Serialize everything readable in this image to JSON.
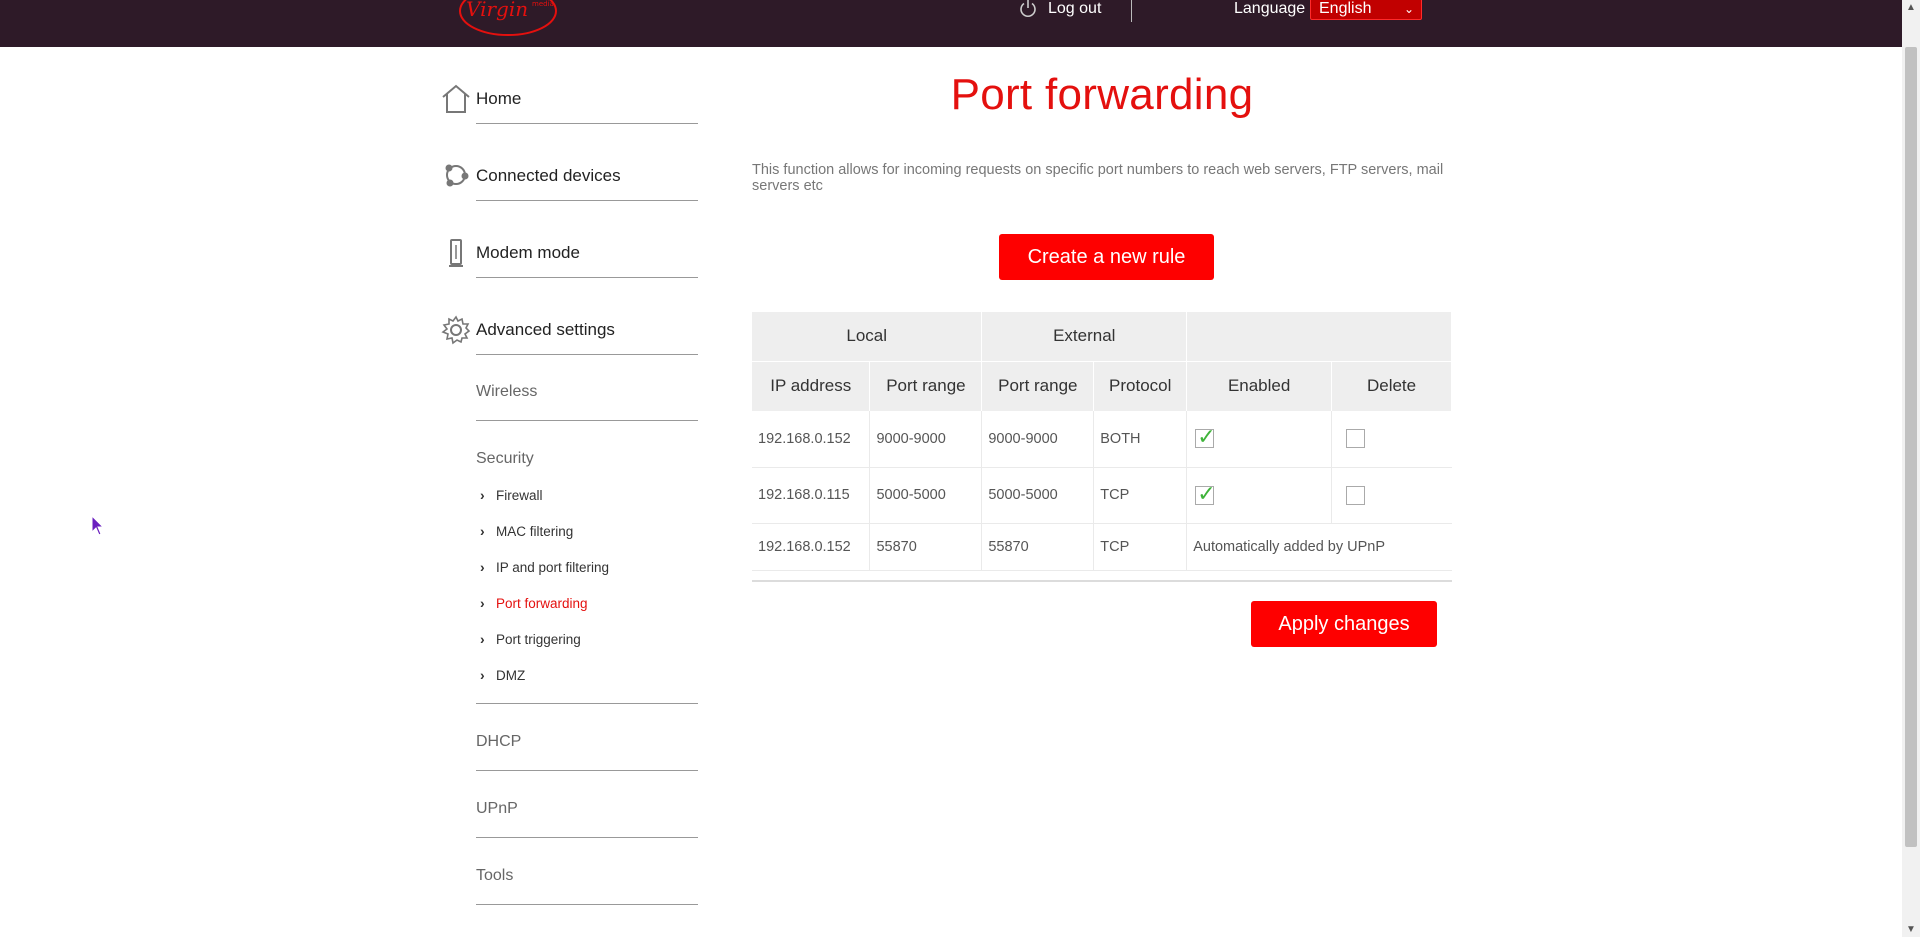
{
  "header": {
    "logout_label": "Log out",
    "language_label": "Language",
    "language_selected": "English",
    "logo_alt": "Virgin media"
  },
  "sidebar": {
    "main_items": [
      {
        "label": "Home",
        "icon": "house-icon"
      },
      {
        "label": "Connected devices",
        "icon": "connected-devices-icon"
      },
      {
        "label": "Modem mode",
        "icon": "modem-icon"
      },
      {
        "label": "Advanced settings",
        "icon": "gear-icon"
      }
    ],
    "advanced": {
      "wireless": "Wireless",
      "security": "Security",
      "security_items": [
        "Firewall",
        "MAC filtering",
        "IP and port filtering",
        "Port forwarding",
        "Port triggering",
        "DMZ"
      ],
      "active_item": "Port forwarding",
      "dhcp": "DHCP",
      "upnp": "UPnP",
      "tools": "Tools"
    }
  },
  "main": {
    "title": "Port forwarding",
    "description": "This function allows for incoming requests on specific port numbers to reach web servers, FTP servers, mail servers etc",
    "create_button": "Create a new rule",
    "apply_button": "Apply changes",
    "table": {
      "group_headers": {
        "local": "Local",
        "external": "External"
      },
      "columns": [
        "IP address",
        "Port range",
        "Port range",
        "Protocol",
        "Enabled",
        "Delete"
      ],
      "rows": [
        {
          "ip": "192.168.0.152",
          "local_range": "9000-9000",
          "external_range": "9000-9000",
          "protocol": "BOTH",
          "enabled": true,
          "delete": false
        },
        {
          "ip": "192.168.0.115",
          "local_range": "5000-5000",
          "external_range": "5000-5000",
          "protocol": "TCP",
          "enabled": true,
          "delete": false
        },
        {
          "ip": "192.168.0.152",
          "local_range": "55870",
          "external_range": "55870",
          "protocol": "TCP",
          "note": "Automatically added by UPnP"
        }
      ]
    }
  },
  "colors": {
    "brand_red": "#e4100e",
    "button_red": "#fe0000",
    "header_bg": "#2e1a28",
    "check_green": "#3fb33a"
  }
}
